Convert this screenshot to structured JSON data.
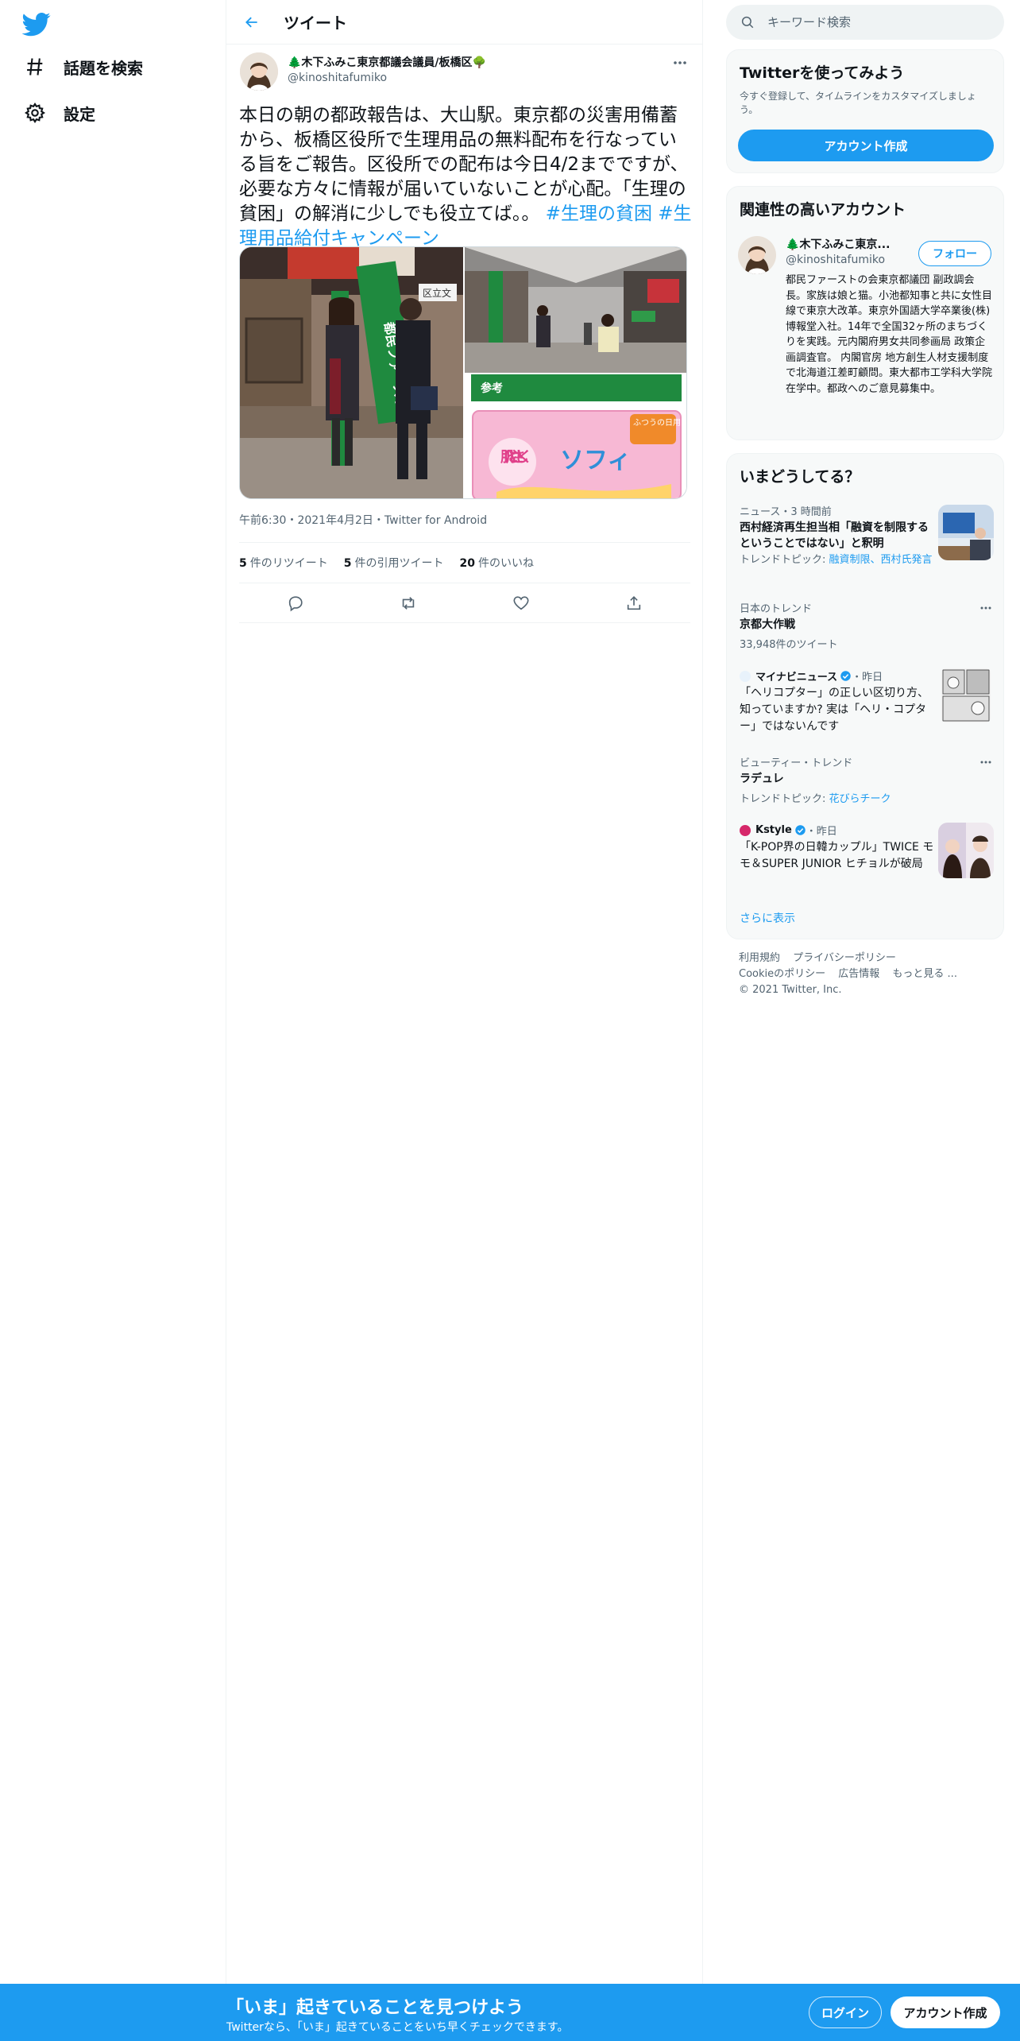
{
  "nav": {
    "explore_label": "話題を検索",
    "settings_label": "設定"
  },
  "header": {
    "title": "ツイート"
  },
  "tweet": {
    "author_name": "🌲木下ふみこ東京都議会議員/板橋区🌳",
    "author_handle": "@kinoshitafumiko",
    "text_main": "本日の朝の都政報告は、大山駅。東京都の災害用備蓄から、板橋区役所で生理用品の無料配布を行なっている旨をご報告。区役所での配布は今日4/2までですが、必要な方々に情報が届いていないことが心配。「生理の貧困」の解消に少しでも役立てば。。",
    "hashtag1": "#生理の貧困",
    "hashtag2": "#生理用品給付キャンペーン",
    "media_caption": "参考",
    "media_product_text": "ソフィ",
    "media_product_side": "肌にやさしく",
    "media_product_top": "ふつうの日用",
    "media_banner": "都民ファースト",
    "media_sign": "区立文",
    "timestamp": "午前6:30・2021年4月2日・Twitter for Android",
    "retweets_count": "5",
    "retweets_label": "件のリツイート",
    "quotes_count": "5",
    "quotes_label": "件の引用ツイート",
    "likes_count": "20",
    "likes_label": "件のいいね"
  },
  "search": {
    "placeholder": "キーワード検索"
  },
  "signup_card": {
    "title": "Twitterを使ってみよう",
    "subtitle": "今すぐ登録して、タイムラインをカスタマイズしましょう。",
    "button": "アカウント作成"
  },
  "related": {
    "title": "関連性の高いアカウント",
    "name": "🌲木下ふみこ東京...",
    "handle": "@kinoshitafumiko",
    "follow": "フォロー",
    "bio": "都民ファーストの会東京都議団 副政調会長。家族は娘と猫。小池都知事と共に女性目線で東京大改革。東京外国語大学卒業後(株)博報堂入社。14年で全国32ヶ所のまちづくりを実践。元内閣府男女共同参画局 政策企画調査官。 内閣官房 地方創生人材支援制度で北海道江差町顧問。東大都市工学科大学院在学中。都政へのご意見募集中。"
  },
  "trends": {
    "title": "いまどうしてる？",
    "items": [
      {
        "meta": "ニュース・3 時間前",
        "title": "西村経済再生担当相「融資を制限するということではない」と釈明",
        "sub_prefix": "トレンドトピック: ",
        "sub_link": "融資制限、西村氏発言"
      },
      {
        "meta": "日本のトレンド",
        "title": "京都大作戦",
        "sub": "33,948件のツイート"
      },
      {
        "source": "マイナビニュース",
        "time": "・昨日",
        "title": "「ヘリコプター」の正しい区切り方、知っていますか? 実は「ヘリ・コプター」ではないんです"
      },
      {
        "meta": "ビューティー・トレンド",
        "title": "ラデュレ",
        "sub_prefix": "トレンドトピック: ",
        "sub_link": "花びらチーク"
      },
      {
        "source": "Kstyle",
        "time": "・昨日",
        "title": "「K-POP界の日韓カップル」TWICE モモ＆SUPER JUNIOR ヒチョルが破局"
      }
    ],
    "show_more": "さらに表示"
  },
  "footer": {
    "terms": "利用規約",
    "privacy": "プライバシーポリシー",
    "cookie": "Cookieのポリシー",
    "ads": "広告情報",
    "more": "もっと見る ...",
    "copyright": "© 2021 Twitter, Inc."
  },
  "bottombar": {
    "title": "「いま」起きていることを見つけよう",
    "subtitle": "Twitterなら、「いま」起きていることをいち早くチェックできます。",
    "login": "ログイン",
    "signup": "アカウント作成"
  },
  "colors": {
    "brand": "#1d9bf0",
    "text": "#0f1419",
    "muted": "#536471"
  }
}
